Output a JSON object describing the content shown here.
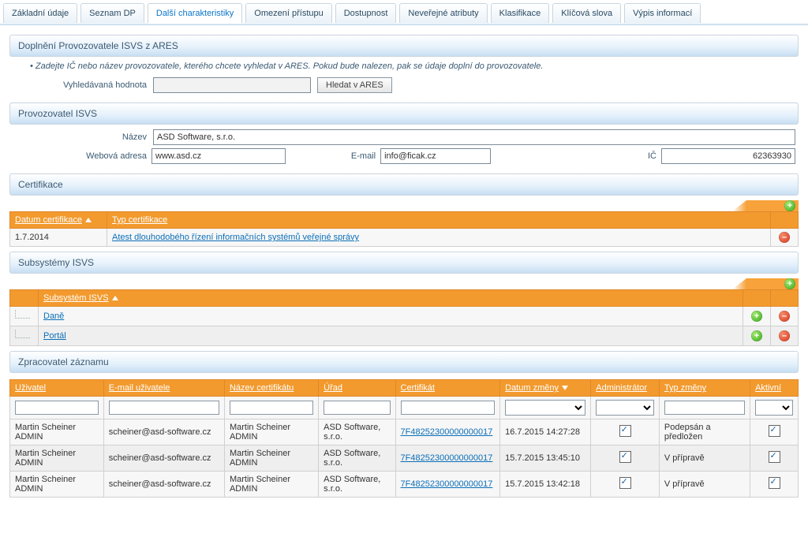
{
  "tabs": [
    {
      "label": "Základní údaje"
    },
    {
      "label": "Seznam DP"
    },
    {
      "label": "Další charakteristiky",
      "active": true
    },
    {
      "label": "Omezení přístupu"
    },
    {
      "label": "Dostupnost"
    },
    {
      "label": "Neveřejné atributy"
    },
    {
      "label": "Klasifikace"
    },
    {
      "label": "Klíčová slova"
    },
    {
      "label": "Výpis informací"
    }
  ],
  "ares": {
    "title": "Doplnění Provozovatele ISVS z ARES",
    "hint": "Zadejte IČ nebo název provozovatele, kterého chcete vyhledat v ARES. Pokud bude nalezen, pak se údaje doplní do provozovatele.",
    "search_label": "Vyhledávaná hodnota",
    "search_value": "",
    "button": "Hledat v ARES"
  },
  "provozovatel": {
    "title": "Provozovatel ISVS",
    "nazev_label": "Název",
    "nazev_value": "ASD Software, s.r.o.",
    "web_label": "Webová adresa",
    "web_value": "www.asd.cz",
    "email_label": "E-mail",
    "email_value": "info@ficak.cz",
    "ic_label": "IČ",
    "ic_value": "62363930"
  },
  "cert": {
    "title": "Certifikace",
    "columns": {
      "datum": "Datum certifikace",
      "typ": "Typ certifikace"
    },
    "rows": [
      {
        "datum": "1.7.2014",
        "typ": "Atest dlouhodobého řízení informačních systémů veřejné správy"
      }
    ]
  },
  "subs": {
    "title": "Subsystémy ISVS",
    "column": "Subsystém ISVS",
    "rows": [
      "Daně",
      "Portál"
    ]
  },
  "zprac": {
    "title": "Zpracovatel záznamu",
    "columns": {
      "uzivatel": "Uživatel",
      "email": "E-mail uživatele",
      "nazevcert": "Název certifikátu",
      "urad": "Úřad",
      "cert": "Certifikát",
      "datum": "Datum změny",
      "admin": "Administrátor",
      "typ": "Typ změny",
      "aktivni": "Aktivní"
    },
    "rows": [
      {
        "uzivatel": "Martin Scheiner ADMIN",
        "email": "scheiner@asd-software.cz",
        "nazevcert": "Martin Scheiner ADMIN",
        "urad": "ASD Software, s.r.o.",
        "cert": "7F48252300000000017",
        "datum": "16.7.2015 14:27:28",
        "admin": true,
        "typ": "Podepsán a předložen",
        "aktivni": true
      },
      {
        "uzivatel": "Martin Scheiner ADMIN",
        "email": "scheiner@asd-software.cz",
        "nazevcert": "Martin Scheiner ADMIN",
        "urad": "ASD Software, s.r.o.",
        "cert": "7F48252300000000017",
        "datum": "15.7.2015 13:45:10",
        "admin": true,
        "typ": "V přípravě",
        "aktivni": true
      },
      {
        "uzivatel": "Martin Scheiner ADMIN",
        "email": "scheiner@asd-software.cz",
        "nazevcert": "Martin Scheiner ADMIN",
        "urad": "ASD Software, s.r.o.",
        "cert": "7F48252300000000017",
        "datum": "15.7.2015 13:42:18",
        "admin": true,
        "typ": "V přípravě",
        "aktivni": true
      }
    ]
  }
}
